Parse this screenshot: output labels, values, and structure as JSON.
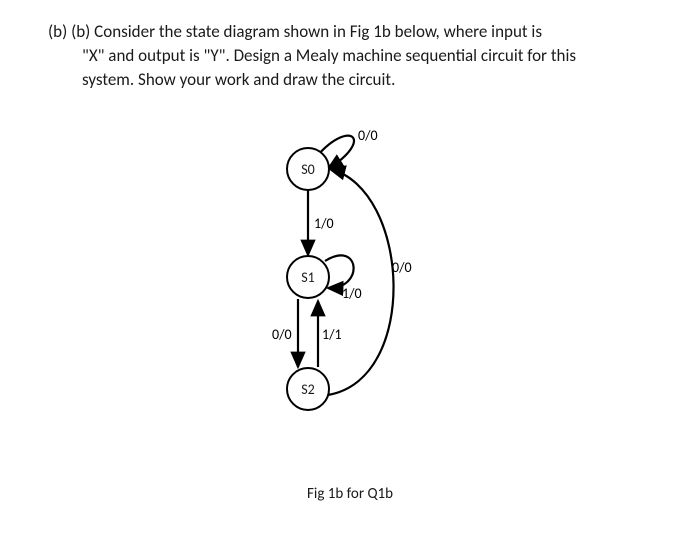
{
  "question": {
    "prefix": "(b) (b)",
    "line1": "Consider the state diagram shown in Fig 1b below, where input is",
    "line2": "\"X\" and output is \"Y\". Design a Mealy machine sequential circuit for this",
    "line3": "system. Show your work and draw the circuit."
  },
  "diagram": {
    "states": {
      "s0": "S0",
      "s1": "S1",
      "s2": "S2"
    },
    "edges": {
      "s0_self": "0/0",
      "s0_s1": "1/0",
      "s1_self": "1/0",
      "s1_s2": "0/0",
      "s2_s1": "1/1",
      "s2_s0": "0/0"
    },
    "caption": "Fig 1b   for Q1b"
  }
}
